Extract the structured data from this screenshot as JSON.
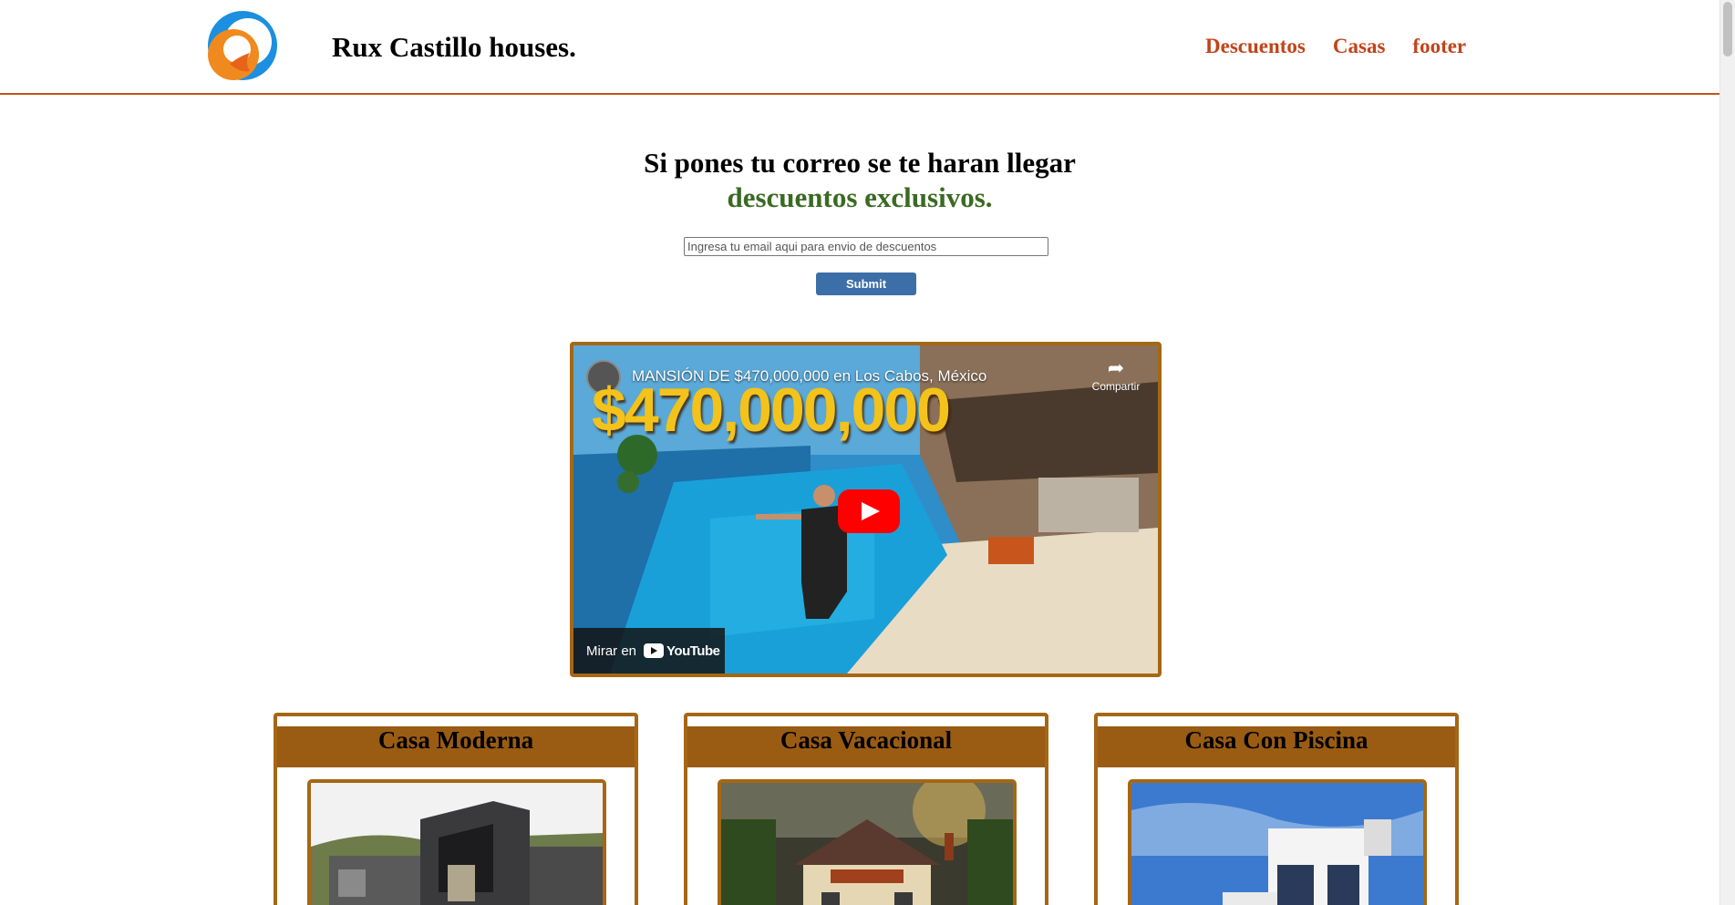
{
  "header": {
    "logo_name": "logo-icon",
    "brand": "Rux Castillo houses.",
    "nav": [
      {
        "label": "Descuentos"
      },
      {
        "label": "Casas"
      },
      {
        "label": "footer"
      }
    ]
  },
  "promo": {
    "line1": "Si pones tu correo se te haran llegar",
    "line2": "descuentos exclusivos.",
    "email_placeholder": "Ingresa tu email aqui para envio de descuentos",
    "submit_label": "Submit"
  },
  "video": {
    "title": "MANSIÓN DE $470,000,000 en Los Cabos, México",
    "thumbnail_text": "$470,000,000",
    "share_label": "Compartir",
    "watch_label": "Mirar en",
    "platform": "YouTube"
  },
  "cards": [
    {
      "title": "Casa Moderna"
    },
    {
      "title": "Casa Vacacional"
    },
    {
      "title": "Casa Con Piscina"
    }
  ],
  "colors": {
    "accent": "#c0441a",
    "border": "#a56714",
    "card_header": "#9a5c13",
    "promo_highlight": "#3a6a22",
    "button": "#3c6ea8"
  }
}
